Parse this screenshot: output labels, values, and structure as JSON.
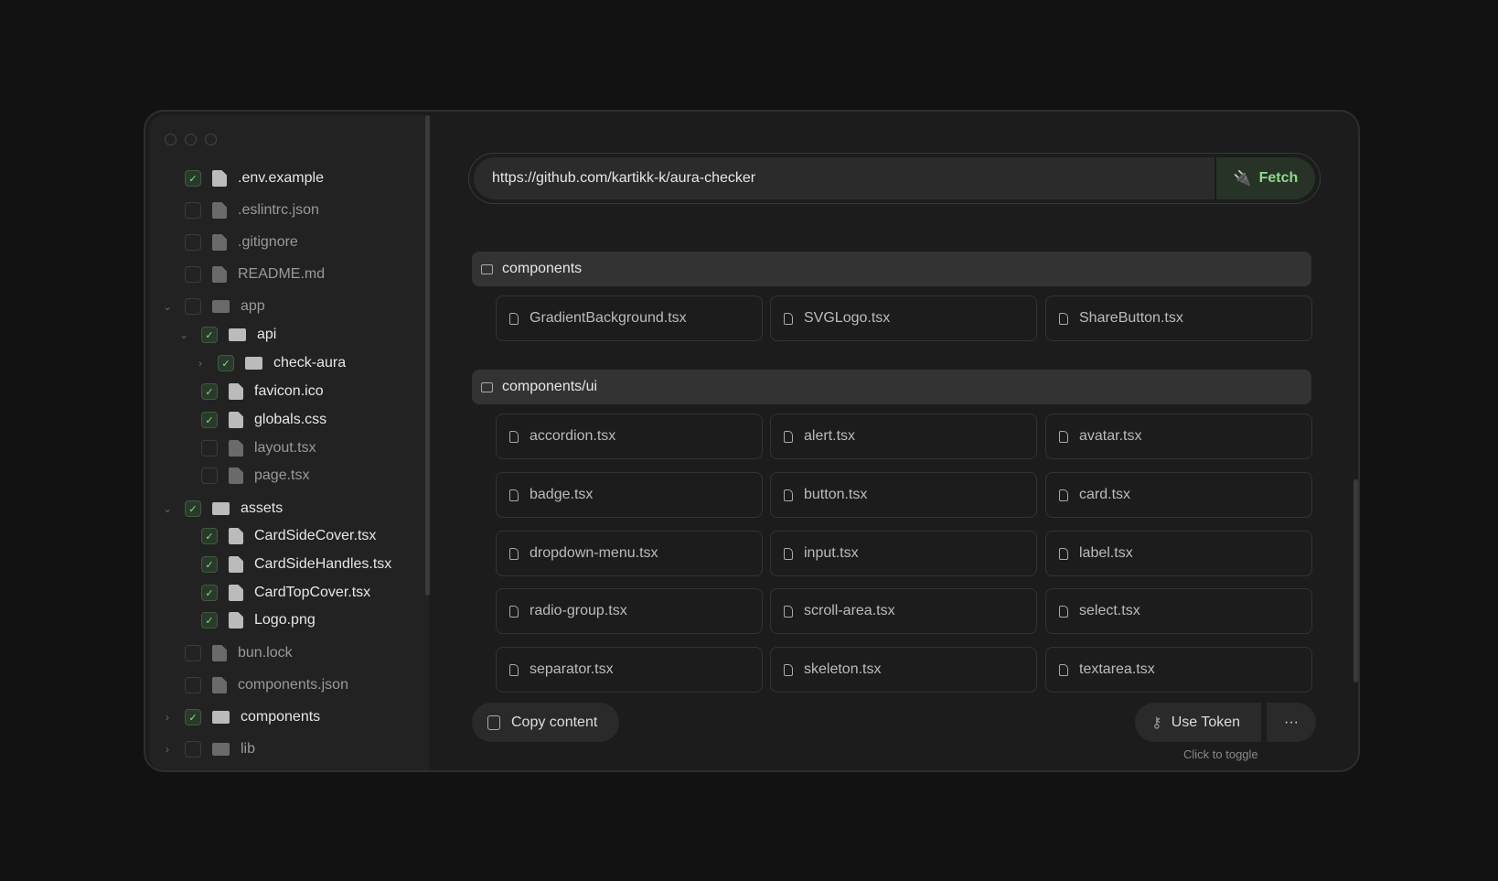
{
  "sidebar": {
    "items": [
      {
        "label": ".env.example",
        "type": "file",
        "level": 0,
        "checked": true
      },
      {
        "label": ".eslintrc.json",
        "type": "file",
        "level": 0,
        "checked": false
      },
      {
        "label": ".gitignore",
        "type": "file",
        "level": 0,
        "checked": false
      },
      {
        "label": "README.md",
        "type": "file",
        "level": 0,
        "checked": false
      },
      {
        "label": "app",
        "type": "folder",
        "level": 0,
        "checked": false,
        "chevron": "down"
      },
      {
        "label": "api",
        "type": "folder",
        "level": 1,
        "checked": true,
        "chevron": "down"
      },
      {
        "label": "check-aura",
        "type": "folder",
        "level": 2,
        "checked": true,
        "chevron": "right"
      },
      {
        "label": "favicon.ico",
        "type": "file",
        "level": 1,
        "checked": true
      },
      {
        "label": "globals.css",
        "type": "file",
        "level": 1,
        "checked": true
      },
      {
        "label": "layout.tsx",
        "type": "file",
        "level": 1,
        "checked": false
      },
      {
        "label": "page.tsx",
        "type": "file",
        "level": 1,
        "checked": false
      },
      {
        "label": "assets",
        "type": "folder",
        "level": 0,
        "checked": true,
        "chevron": "down"
      },
      {
        "label": "CardSideCover.tsx",
        "type": "file",
        "level": 1,
        "checked": true
      },
      {
        "label": "CardSideHandles.tsx",
        "type": "file",
        "level": 1,
        "checked": true
      },
      {
        "label": "CardTopCover.tsx",
        "type": "file",
        "level": 1,
        "checked": true
      },
      {
        "label": "Logo.png",
        "type": "file",
        "level": 1,
        "checked": true
      },
      {
        "label": "bun.lock",
        "type": "file",
        "level": 0,
        "checked": false
      },
      {
        "label": "components.json",
        "type": "file",
        "level": 0,
        "checked": false
      },
      {
        "label": "components",
        "type": "folder",
        "level": 0,
        "checked": true,
        "chevron": "right"
      },
      {
        "label": "lib",
        "type": "folder",
        "level": 0,
        "checked": false,
        "chevron": "right"
      }
    ]
  },
  "url": {
    "value": "https://github.com/kartikk-k/aura-checker",
    "fetch_label": "Fetch"
  },
  "groups": [
    {
      "name": "components",
      "files": [
        "GradientBackground.tsx",
        "SVGLogo.tsx",
        "ShareButton.tsx"
      ]
    },
    {
      "name": "components/ui",
      "files": [
        "accordion.tsx",
        "alert.tsx",
        "avatar.tsx",
        "badge.tsx",
        "button.tsx",
        "card.tsx",
        "dropdown-menu.tsx",
        "input.tsx",
        "label.tsx",
        "radio-group.tsx",
        "scroll-area.tsx",
        "select.tsx",
        "separator.tsx",
        "skeleton.tsx",
        "textarea.tsx"
      ]
    }
  ],
  "footer": {
    "copy_label": "Copy content",
    "token_label": "Use Token",
    "more_label": "···",
    "hint": "Click to toggle"
  },
  "colors": {
    "accent": "#8ed88e"
  }
}
